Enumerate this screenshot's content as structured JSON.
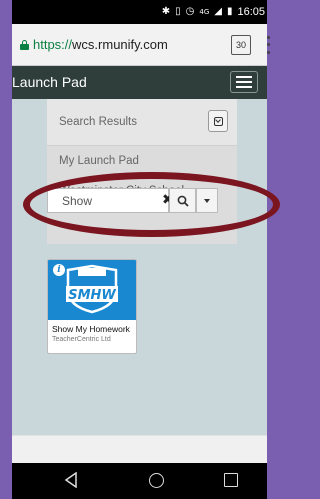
{
  "status_bar": {
    "time": "16:05",
    "network": "4G"
  },
  "browser": {
    "url_scheme": "https://",
    "url_host": "wcs.rmunify.com",
    "tab_count": "30"
  },
  "app_bar": {
    "title": "Launch Pad"
  },
  "dropdown": {
    "items": [
      "Search Results",
      "My Launch Pad",
      "Westminster City School"
    ]
  },
  "search": {
    "value": "Show"
  },
  "app_tile": {
    "logo_text": "SMHW",
    "name": "Show My Homework",
    "vendor": "TeacherCentric Ltd"
  },
  "colors": {
    "frame": "#7a5fb0",
    "appbar": "#2f3d3b",
    "content_bg": "#c9d6da",
    "highlight_ellipse": "#7b1621",
    "tile_logo_bg": "#1a88d0",
    "url_green": "#0b8043"
  }
}
